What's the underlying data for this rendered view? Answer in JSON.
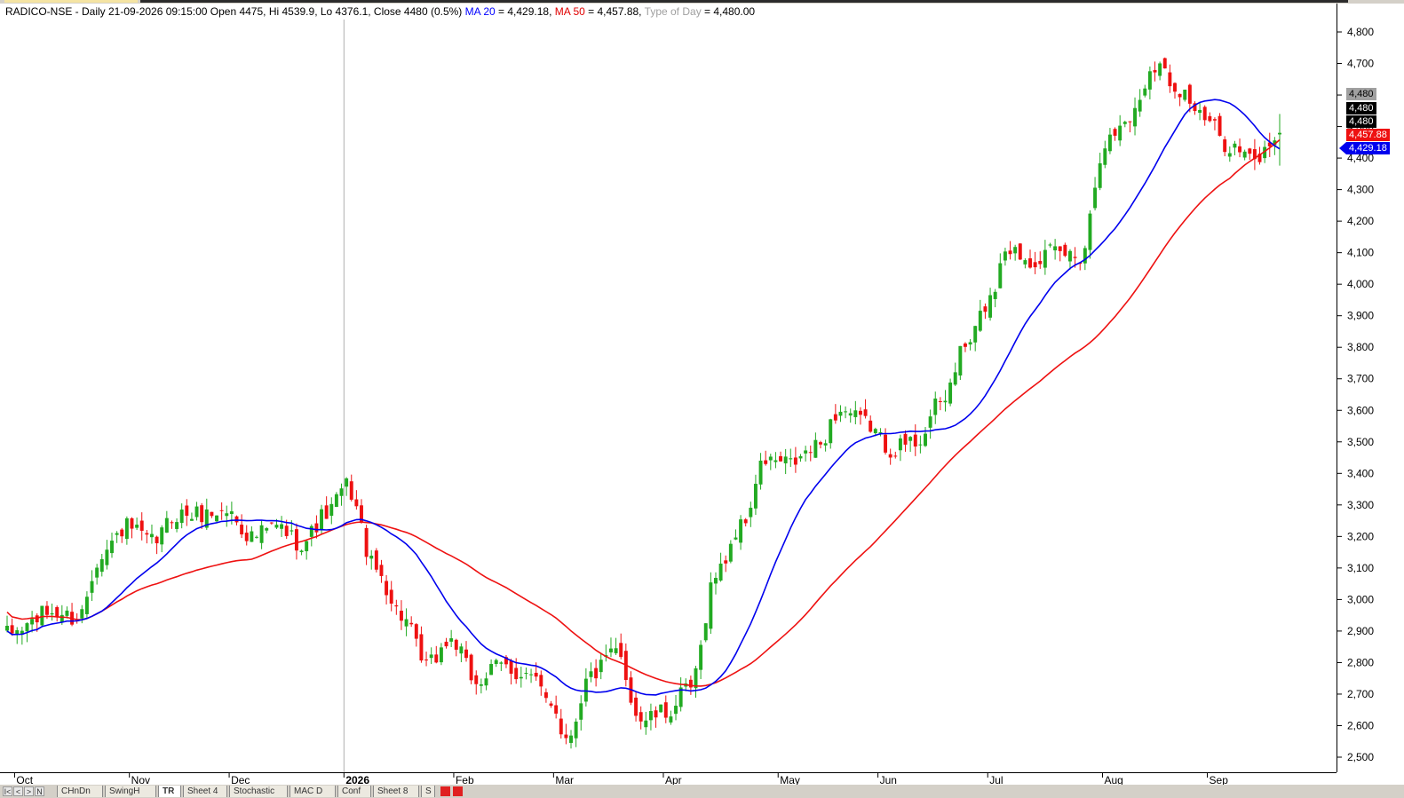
{
  "header": {
    "symbol": "RADICO-NSE",
    "info_main": "RADICO-NSE - Daily 21-09-2026 09:15:00 Open 4475, Hi 4539.9, Lo 4376.1, Close 4480 (0.5%)",
    "ma20_label": "MA 20",
    "ma20_value": " = 4,429.18,",
    "ma50_label": "MA 50",
    "ma50_value": " = 4,457.88,",
    "tod_label": "Type of Day",
    "tod_value": " = 4,480.00"
  },
  "price_tags": {
    "last_grey": "4,480",
    "close_black_1": "4,480",
    "close_black_2": "4,480",
    "ma50": "4,457.88",
    "ma20": "4,429.18"
  },
  "sheet_tabs": {
    "nav_labels": [
      "I<",
      "<",
      ">",
      "N"
    ],
    "tabs": [
      "CHnDn",
      "SwingH",
      "TR",
      "Sheet 4",
      "Stochastic",
      "MAC D",
      "Conf",
      "Sheet 8",
      "S"
    ],
    "active": "TR"
  },
  "colors": {
    "up": "#22aa22",
    "down": "#ee1111",
    "ma20": "#0000ee",
    "ma50": "#ee1111",
    "axis": "#000000",
    "separator": "#b0b0b0"
  },
  "chart_data": {
    "type": "candlestick",
    "title": "RADICO-NSE - Daily",
    "ylim": [
      2470,
      4850
    ],
    "y_ticks": [
      2500,
      2600,
      2700,
      2800,
      2900,
      3000,
      3100,
      3200,
      3300,
      3400,
      3500,
      3600,
      3700,
      3800,
      3900,
      4000,
      4100,
      4200,
      4300,
      4400,
      4500,
      4600,
      4700,
      4800
    ],
    "y_tick_labels": [
      "2,500",
      "2,600",
      "2,700",
      "2,800",
      "2,900",
      "3,000",
      "3,100",
      "3,200",
      "3,300",
      "3,400",
      "3,500",
      "3,600",
      "3,700",
      "3,800",
      "3,900",
      "4,000",
      "4,100",
      "4,200",
      "4,300",
      "4,400",
      "4,500",
      "4,600",
      "4,700",
      "4,800"
    ],
    "x_month_labels": [
      "Oct",
      "Nov",
      "Dec",
      "2026",
      "Feb",
      "Mar",
      "Apr",
      "May",
      "Jun",
      "Jul",
      "Aug",
      "Sep"
    ],
    "x_month_dates": [
      "2025-10-01",
      "2025-11-03",
      "2025-12-01",
      "2026-01-01",
      "2026-02-02",
      "2026-03-02",
      "2026-04-01",
      "2026-05-04",
      "2026-06-01",
      "2026-07-01",
      "2026-08-03",
      "2026-09-01"
    ],
    "last_date": "2026-09-21",
    "close_path": [
      [
        "2025-09-29",
        2890
      ],
      [
        "2025-10-10",
        2960
      ],
      [
        "2025-10-17",
        2940
      ],
      [
        "2025-10-24",
        3150
      ],
      [
        "2025-10-31",
        3230
      ],
      [
        "2025-11-07",
        3180
      ],
      [
        "2025-11-14",
        3270
      ],
      [
        "2025-11-21",
        3270
      ],
      [
        "2025-11-28",
        3280
      ],
      [
        "2025-12-05",
        3200
      ],
      [
        "2025-12-12",
        3230
      ],
      [
        "2025-12-19",
        3180
      ],
      [
        "2025-12-26",
        3270
      ],
      [
        "2026-01-01",
        3360
      ],
      [
        "2026-01-09",
        3090
      ],
      [
        "2026-01-16",
        2950
      ],
      [
        "2026-01-23",
        2790
      ],
      [
        "2026-01-30",
        2870
      ],
      [
        "2026-02-06",
        2740
      ],
      [
        "2026-02-13",
        2790
      ],
      [
        "2026-02-20",
        2760
      ],
      [
        "2026-02-27",
        2680
      ],
      [
        "2026-03-04",
        2560
      ],
      [
        "2026-03-11",
        2760
      ],
      [
        "2026-03-18",
        2830
      ],
      [
        "2026-03-25",
        2620
      ],
      [
        "2026-04-01",
        2640
      ],
      [
        "2026-04-08",
        2720
      ],
      [
        "2026-04-15",
        3080
      ],
      [
        "2026-04-22",
        3230
      ],
      [
        "2026-04-29",
        3440
      ],
      [
        "2026-05-06",
        3430
      ],
      [
        "2026-05-13",
        3480
      ],
      [
        "2026-05-20",
        3600
      ],
      [
        "2026-05-27",
        3560
      ],
      [
        "2026-06-03",
        3480
      ],
      [
        "2026-06-10",
        3500
      ],
      [
        "2026-06-17",
        3620
      ],
      [
        "2026-06-24",
        3800
      ],
      [
        "2026-07-01",
        3950
      ],
      [
        "2026-07-06",
        4120
      ],
      [
        "2026-07-13",
        4080
      ],
      [
        "2026-07-20",
        4100
      ],
      [
        "2026-07-27",
        4090
      ],
      [
        "2026-08-03",
        4450
      ],
      [
        "2026-08-10",
        4530
      ],
      [
        "2026-08-17",
        4700
      ],
      [
        "2026-08-24",
        4620
      ],
      [
        "2026-08-31",
        4520
      ],
      [
        "2026-09-07",
        4440
      ],
      [
        "2026-09-14",
        4390
      ],
      [
        "2026-09-21",
        4480
      ]
    ],
    "last_candle": {
      "date": "2026-09-21",
      "open": 4475,
      "high": 4539.9,
      "low": 4376.1,
      "close": 4480
    },
    "ma20_last": 4429.18,
    "ma50_last": 4457.88,
    "ma20_first": 2900,
    "ma50_first": 2960,
    "grid": false,
    "series": [
      {
        "name": "MA 20",
        "color": "#0000ee"
      },
      {
        "name": "MA 50",
        "color": "#ee1111"
      }
    ]
  }
}
